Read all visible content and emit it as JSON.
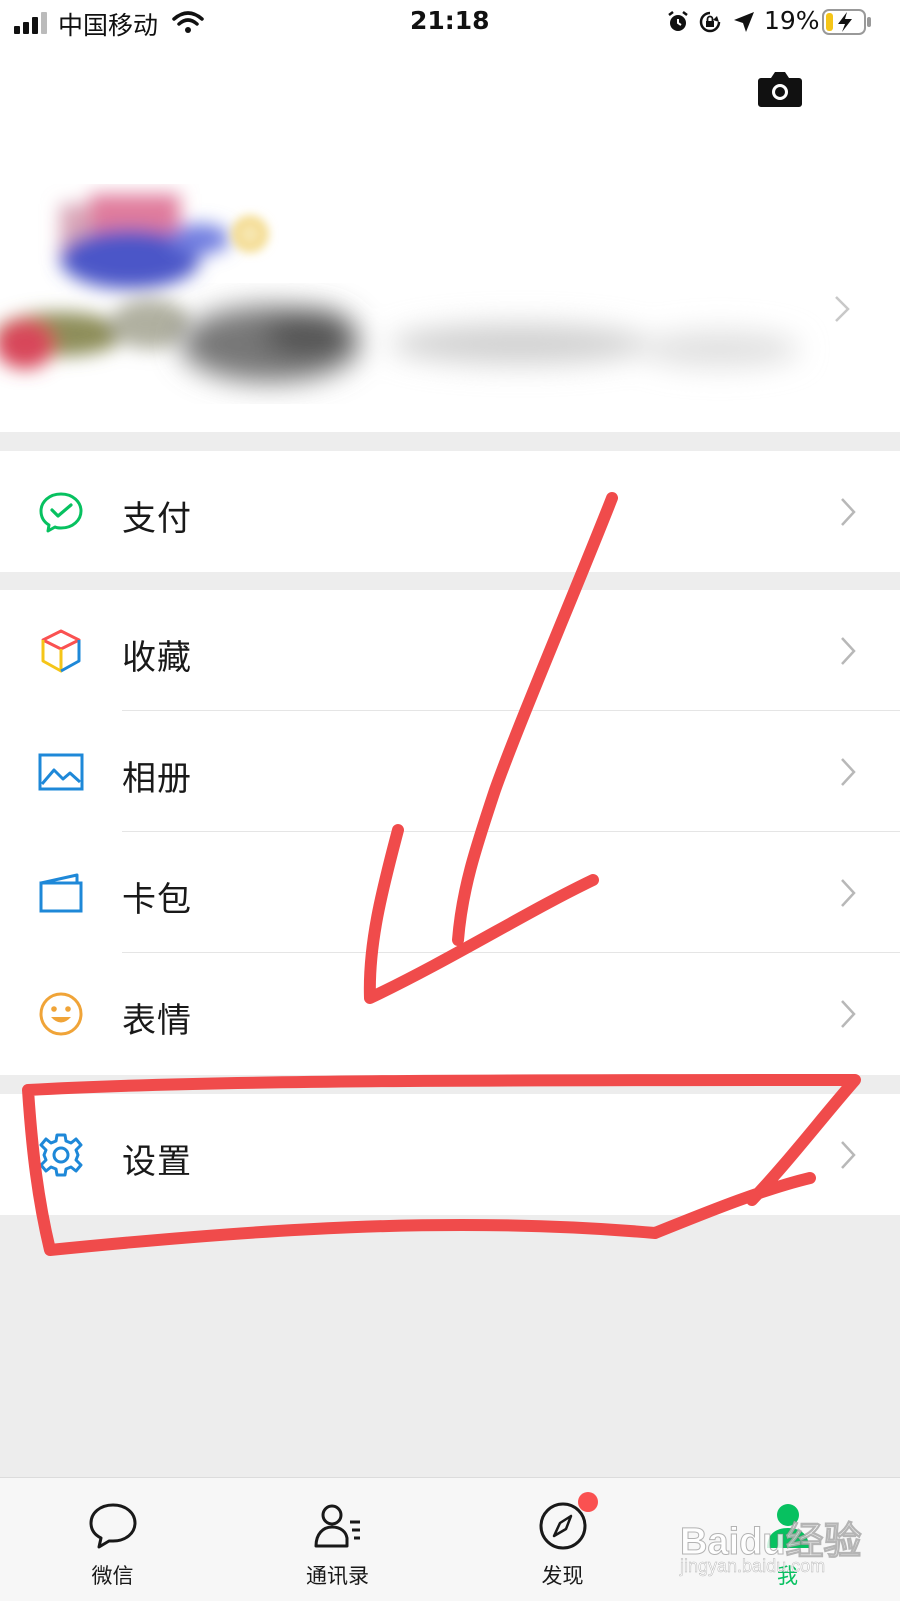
{
  "status_bar": {
    "carrier": "中国移动",
    "time": "21:18",
    "battery_percent": "19%",
    "battery_level": 0.19,
    "icons": [
      "signal-icon",
      "wifi-icon",
      "alarm-icon",
      "rotation-lock-icon",
      "location-icon",
      "battery-charging-icon"
    ]
  },
  "header": {
    "camera_icon": "camera-icon",
    "profile_note": "",
    "chevron_icon": "chevron-right-icon"
  },
  "menu": {
    "pay": {
      "label": "支付",
      "icon": "pay-icon",
      "color": "#07c160"
    },
    "favorites": {
      "label": "收藏",
      "icon": "favorites-cube-icon"
    },
    "album": {
      "label": "相册",
      "icon": "album-icon",
      "color": "#1e88d8"
    },
    "cards": {
      "label": "卡包",
      "icon": "card-wallet-icon",
      "color": "#1e88d8"
    },
    "stickers": {
      "label": "表情",
      "icon": "smiley-icon",
      "color": "#f0a438"
    },
    "settings": {
      "label": "设置",
      "icon": "gear-icon",
      "color": "#1e88d8"
    }
  },
  "tab_bar": {
    "tabs": [
      {
        "label": "微信",
        "icon": "chat-bubble-icon",
        "active": false
      },
      {
        "label": "通讯录",
        "icon": "contacts-icon",
        "active": false
      },
      {
        "label": "发现",
        "icon": "compass-icon",
        "active": false,
        "badge": true
      },
      {
        "label": "我",
        "icon": "me-person-icon",
        "active": true
      }
    ],
    "active_color": "#07c160",
    "badge_color": "#fa5151"
  },
  "watermark": {
    "brand": "Baidu经验",
    "url": "jingyan.baidu.com"
  },
  "annotation": {
    "color": "#f04b4b",
    "shapes": [
      "arrow-pointing-down",
      "rectangle-around-settings"
    ]
  }
}
